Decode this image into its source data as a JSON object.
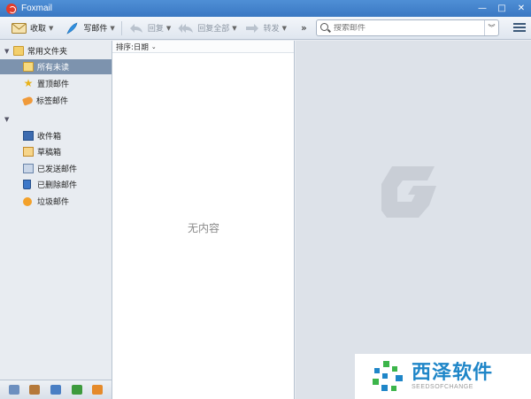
{
  "window": {
    "title": "Foxmail",
    "controls": [
      "—",
      "□",
      "✕"
    ]
  },
  "toolbar": {
    "receive": "收取",
    "compose": "写邮件",
    "reply": "回复",
    "reply_all": "回复全部",
    "forward": "转发",
    "more": "»",
    "search_placeholder": "搜索邮件"
  },
  "sidebar": {
    "groups": [
      {
        "label": "常用文件夹",
        "items": [
          {
            "label": "所有未读",
            "selected": true
          },
          {
            "label": "置顶邮件",
            "selected": false
          },
          {
            "label": "标签邮件",
            "selected": false
          }
        ]
      },
      {
        "label": "",
        "items": [
          {
            "label": "收件箱"
          },
          {
            "label": "草稿箱"
          },
          {
            "label": "已发送邮件"
          },
          {
            "label": "已删除邮件"
          },
          {
            "label": "垃圾邮件"
          }
        ]
      }
    ]
  },
  "message_list": {
    "sort_label": "排序:日期",
    "empty_text": "无内容"
  },
  "watermark": {
    "name": "西泽软件",
    "sub": "SEEDSOFCHANGE"
  },
  "colors": {
    "accent": "#3a78c2",
    "selected": "#7d93ae",
    "watermark": "#1f86c8"
  }
}
